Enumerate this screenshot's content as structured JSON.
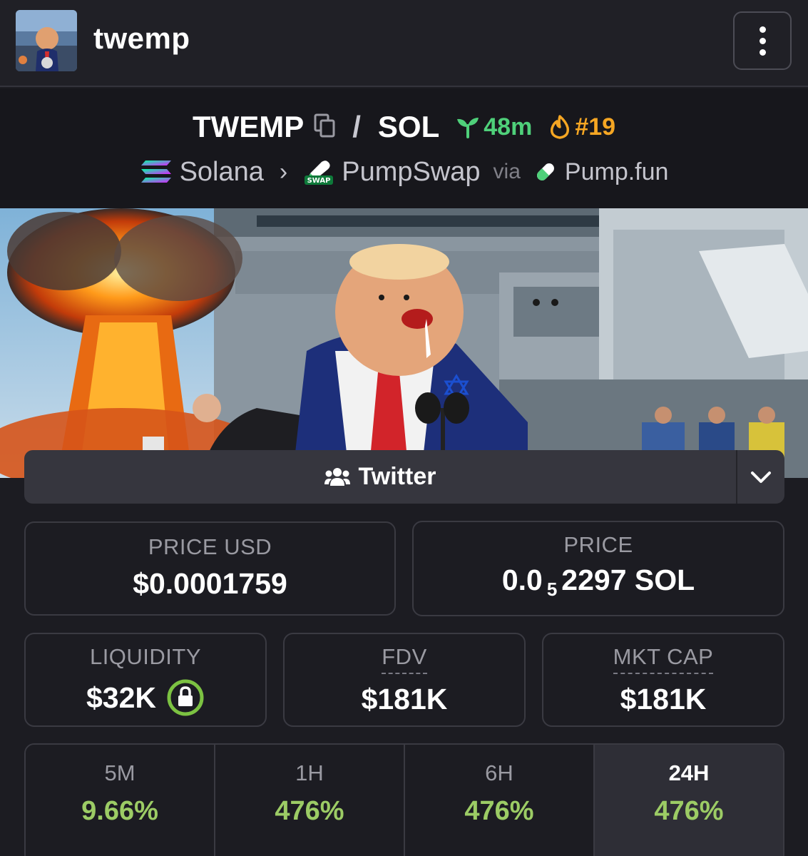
{
  "header": {
    "app_name": "twemp"
  },
  "pair": {
    "base": "TWEMP",
    "quote": "SOL",
    "age": "48m",
    "rank": "#19",
    "chain": "Solana",
    "dex": "PumpSwap",
    "dex_badge": "SWAP",
    "via_label": "via",
    "launchpad": "Pump.fun"
  },
  "social": {
    "label": "Twitter"
  },
  "stats": {
    "price_usd_label": "PRICE USD",
    "price_usd": "$0.0001759",
    "price_label": "PRICE",
    "price_sol_prefix": "0.0",
    "price_sol_zeros": "5",
    "price_sol_digits": "2297 SOL",
    "liquidity_label": "LIQUIDITY",
    "liquidity": "$32K",
    "fdv_label": "FDV",
    "fdv": "$181K",
    "mcap_label": "MKT CAP",
    "mcap": "$181K"
  },
  "timeframes": [
    {
      "label": "5M",
      "change": "9.66%"
    },
    {
      "label": "1H",
      "change": "476%"
    },
    {
      "label": "6H",
      "change": "476%"
    },
    {
      "label": "24H",
      "change": "476%"
    }
  ],
  "colors": {
    "positive": "#9ccc65",
    "age": "#4fd07a",
    "rank": "#f5a623",
    "lock": "#7cc242"
  },
  "icons": {
    "menu": "vertical-dots-icon",
    "copy": "copy-icon",
    "age": "seedling-icon",
    "rank": "flame-icon",
    "chain": "solana-icon",
    "dex": "pumpswap-icon",
    "launchpad": "pill-icon",
    "social": "users-icon",
    "dropdown": "chevron-down-icon",
    "lock": "lock-icon"
  }
}
